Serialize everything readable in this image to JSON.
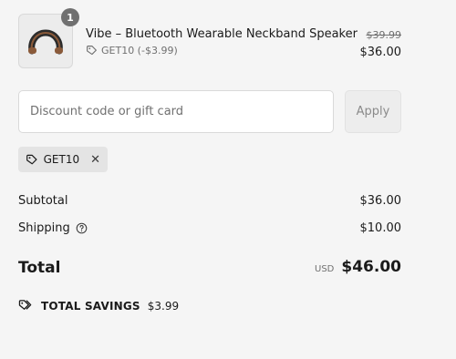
{
  "product": {
    "quantity": "1",
    "name": "Vibe – Bluetooth Wearable Neckband Speaker",
    "discount_applied": "GET10 (-$3.99)",
    "original_price": "$39.99",
    "price": "$36.00",
    "image": "neckband-speaker-thumbnail"
  },
  "discount": {
    "placeholder": "Discount code or gift card",
    "apply_label": "Apply",
    "applied_code": "GET10"
  },
  "summary": {
    "subtotal_label": "Subtotal",
    "subtotal_value": "$36.00",
    "shipping_label": "Shipping",
    "shipping_value": "$10.00",
    "total_label": "Total",
    "currency": "USD",
    "total_value": "$46.00",
    "savings_label": "TOTAL SAVINGS",
    "savings_value": "$3.99"
  },
  "icons": {
    "tag": "tag-icon",
    "close": "close-icon",
    "help": "help-circle-icon",
    "savings": "tags-icon"
  },
  "colors": {
    "background": "#f5f5f5",
    "text": "#1a1a1a",
    "muted": "#707070",
    "chip": "#e4e4e4",
    "badge": "#707070"
  }
}
